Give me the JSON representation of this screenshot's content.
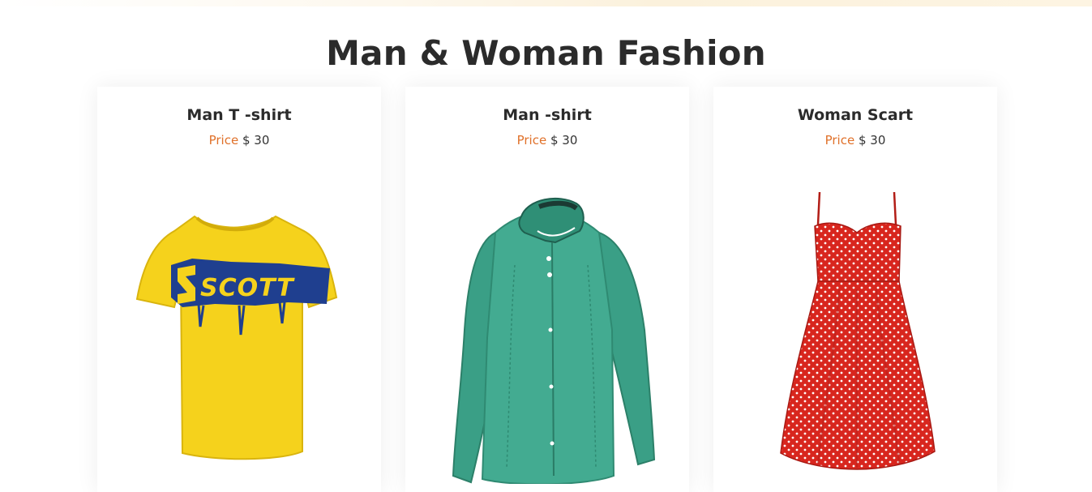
{
  "section": {
    "title": "Man & Woman Fashion"
  },
  "colors": {
    "heading": "#2b2b2b",
    "price_label": "#e0712a",
    "card_background": "#ffffff"
  },
  "products": [
    {
      "name": "Man T -shirt",
      "price_label": "Price",
      "price_value": "$ 30",
      "image_icon": "yellow-tshirt-image",
      "image_text": "SCOTT"
    },
    {
      "name": "Man -shirt",
      "price_label": "Price",
      "price_value": "$ 30",
      "image_icon": "green-shirt-image"
    },
    {
      "name": "Woman Scart",
      "price_label": "Price",
      "price_value": "$ 30",
      "image_icon": "red-dress-image"
    }
  ]
}
